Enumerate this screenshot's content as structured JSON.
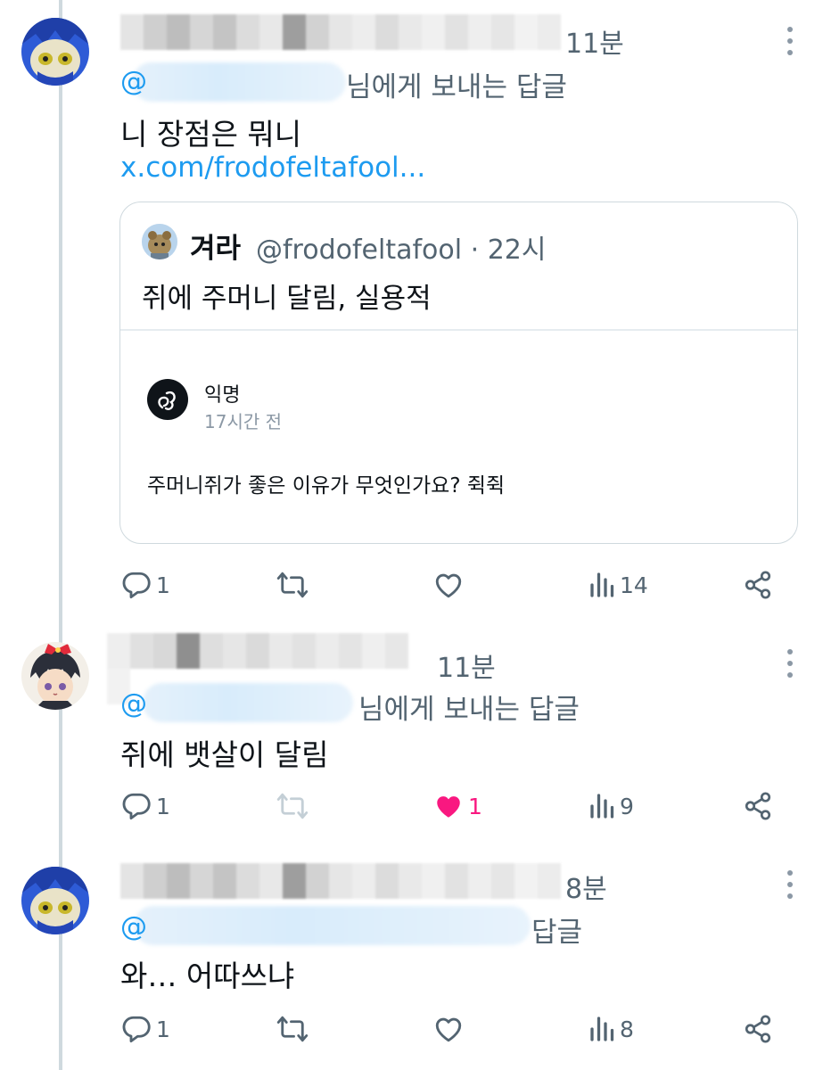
{
  "colors": {
    "accent": "#1d9bf0",
    "like": "#f91880",
    "muted": "#536471",
    "thread_line": "#cfd9de"
  },
  "tweets": [
    {
      "time": "11분",
      "reply_to_prefix": "@",
      "reply_to_suffix": "님에게 보내는 답글",
      "text": "니 장점은 뭐니",
      "link": "x.com/frodofeltafool...",
      "quote": {
        "name": "겨라",
        "handle_time": "@frodofeltafool · 22시",
        "text": "쥐에 주머니 달림, 실용적",
        "embed": {
          "name": "익명",
          "time": "17시간 전",
          "question": "주머니쥐가 좋은 이유가 무엇인가요? 쥑쥑"
        }
      },
      "actions": {
        "replies": "1",
        "views": "14"
      }
    },
    {
      "time": "11분",
      "reply_to_prefix": "@",
      "reply_to_suffix": "님에게 보내는 답글",
      "text": "쥐에 뱃살이 달림",
      "actions": {
        "replies": "1",
        "likes": "1",
        "views": "9"
      }
    },
    {
      "time": "8분",
      "reply_to_prefix": "@",
      "reply_to_suffix": "답글",
      "text": "와… 어따쓰냐",
      "actions": {
        "replies": "1",
        "views": "8"
      }
    }
  ],
  "icons": [
    "reply-icon",
    "retweet-icon",
    "like-icon",
    "views-icon",
    "share-icon",
    "more-icon"
  ]
}
